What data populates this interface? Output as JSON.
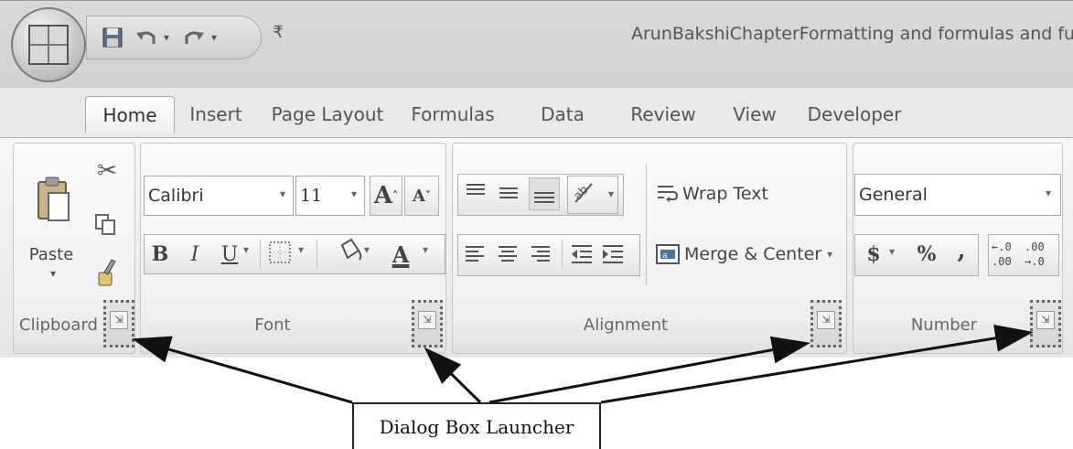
{
  "window": {
    "title": "ArunBakshiChapterFormatting and formulas and functions"
  },
  "quick_access": {
    "customize": "₹"
  },
  "tabs": [
    {
      "label": "Home",
      "active": true
    },
    {
      "label": "Insert"
    },
    {
      "label": "Page Layout"
    },
    {
      "label": "Formulas"
    },
    {
      "label": "Data"
    },
    {
      "label": "Review"
    },
    {
      "label": "View"
    },
    {
      "label": "Developer"
    }
  ],
  "clipboard": {
    "label": "Clipboard",
    "paste": "Paste",
    "icons": [
      "paste-icon",
      "cut-icon",
      "copy-icon",
      "format-painter-icon"
    ]
  },
  "font": {
    "label": "Font",
    "name": "Calibri",
    "size": "11",
    "grow": "A",
    "shrink": "A",
    "bold": "B",
    "italic": "I",
    "underline": "U",
    "font_color": "A"
  },
  "alignment": {
    "label": "Alignment",
    "wrap_text": "Wrap Text",
    "merge_center": "Merge & Center"
  },
  "number": {
    "label": "Number",
    "format": "General",
    "currency": "$",
    "percent": "%",
    "comma": ",",
    "inc_decimal_top": "←.0",
    "inc_decimal_bottom": ".00",
    "dec_decimal_top": ".00",
    "dec_decimal_bottom": "→.0"
  },
  "callout": {
    "text": "Dialog Box Launcher"
  },
  "colors": {
    "ribbon": "#efefef",
    "titlebar": "#d4d4d4",
    "annotation": "#111111"
  }
}
